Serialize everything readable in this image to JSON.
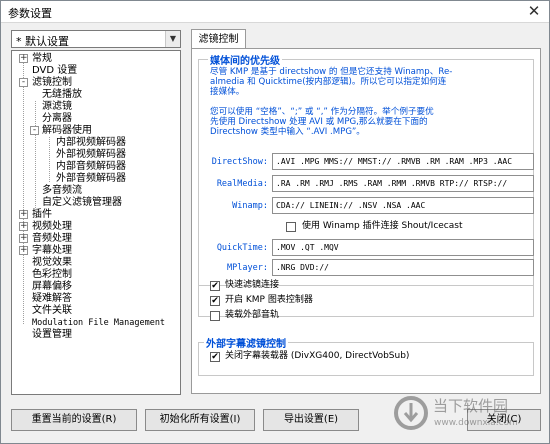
{
  "window": {
    "title": "参数设置",
    "close_glyph": "✕"
  },
  "profile": {
    "selected": "* 默认设置",
    "arrow": "▼"
  },
  "tree": [
    {
      "label": "常规",
      "expander": "+"
    },
    {
      "label": "DVD 设置"
    },
    {
      "label": "滤镜控制",
      "expander": "-"
    },
    {
      "label": "无缝播放"
    },
    {
      "label": "源滤镜"
    },
    {
      "label": "分离器"
    },
    {
      "label": "解码器使用",
      "expander": "-"
    },
    {
      "label": "内部视频解码器"
    },
    {
      "label": "外部视频解码器"
    },
    {
      "label": "内部音频解码器"
    },
    {
      "label": "外部音频解码器"
    },
    {
      "label": "多音频流"
    },
    {
      "label": "自定义滤镜管理器"
    },
    {
      "label": "插件",
      "expander": "+"
    },
    {
      "label": "视频处理",
      "expander": "+"
    },
    {
      "label": "音频处理",
      "expander": "+"
    },
    {
      "label": "字幕处理",
      "expander": "+"
    },
    {
      "label": "视觉效果"
    },
    {
      "label": "色彩控制"
    },
    {
      "label": "屏幕偏移"
    },
    {
      "label": "疑难解答"
    },
    {
      "label": "文件关联"
    },
    {
      "label": "Modulation File Management"
    },
    {
      "label": "设置管理"
    }
  ],
  "tabs": {
    "active": "滤镜控制"
  },
  "priority_group": {
    "title": "媒体间的优先级",
    "description_lines": [
      "尽管 KMP 是基于 directshow 的 但是它还支持 Winamp、Re-",
      "almedia 和 Quicktime(按内部逻辑)。所以它可以指定如何连",
      "接媒体。",
      "",
      "您可以使用 “空格”、“;” 或 “,” 作为分隔符。举个例子要优",
      "先使用 Directshow 处理 AVI 或 MPG,那么就要在下面的",
      "Directshow 类型中输入 “.AVI .MPG”。"
    ],
    "fields": [
      {
        "label": "DirectShow:",
        "value": ".AVI .MPG MMS:// MMST:// .RMVB .RM .RAM .MP3 .AAC"
      },
      {
        "label": "RealMedia:",
        "value": ".RA .RM .RMJ .RMS .RAM .RMM .RMVB RTP:// RTSP://"
      },
      {
        "label": "Winamp:",
        "value": "CDA:// LINEIN:// .NSV .NSA .AAC"
      },
      {
        "label": "QuickTime:",
        "value": ".MOV .QT .MQV"
      },
      {
        "label": "MPlayer:",
        "value": ".NRG DVD://"
      }
    ],
    "winamp_plugin": {
      "label": "使用 Winamp 插件连接 Shout/Icecast",
      "checked": false
    }
  },
  "options": [
    {
      "label": "快速滤镜连接",
      "checked": true
    },
    {
      "label": "开启 KMP 图表控制器",
      "checked": true
    },
    {
      "label": "装载外部音轨",
      "checked": false
    }
  ],
  "subtitle_group": {
    "title": "外部字幕滤镜控制",
    "option": {
      "label": "关闭字幕装载器 (DivXG400, DirectVobSub)",
      "checked": true
    }
  },
  "buttons": {
    "reset": "重置当前的设置(R)",
    "init_all": "初始化所有设置(I)",
    "export": "导出设置(E)",
    "close": "关闭(C)"
  },
  "watermark": {
    "text": "当下软件园",
    "url": "www.downxia.com"
  },
  "colors": {
    "accent_blue": "#0050d8",
    "window_bg": "#f0f0f0"
  }
}
